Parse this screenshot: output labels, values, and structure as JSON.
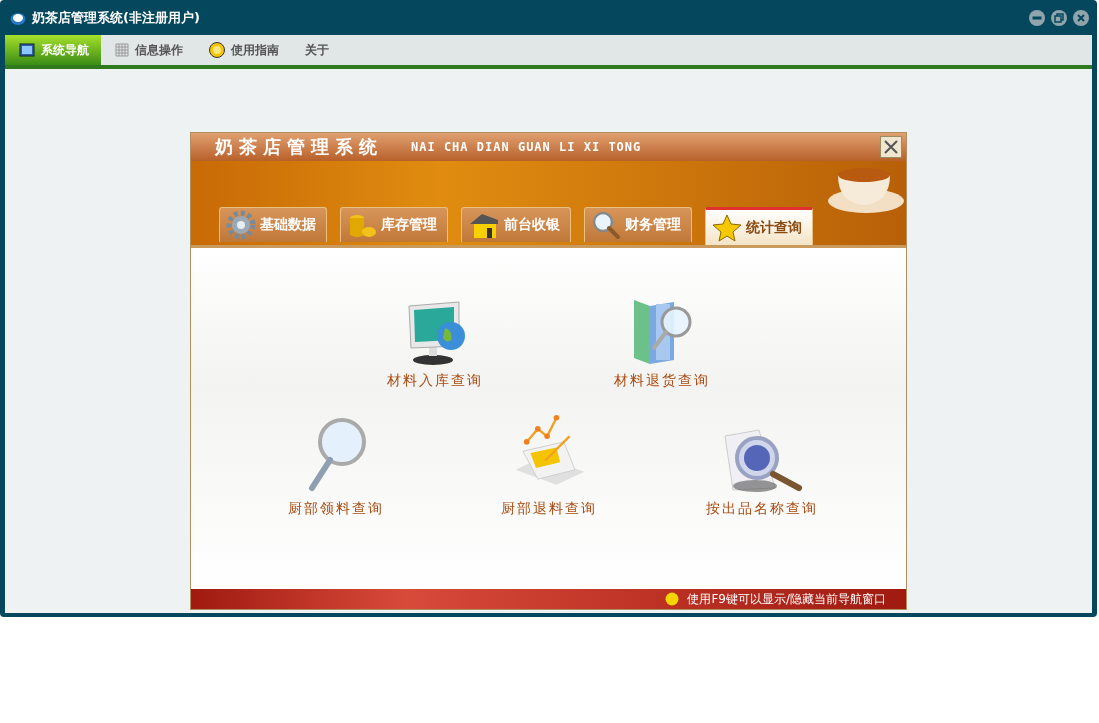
{
  "window": {
    "title": "奶茶店管理系统(非注册用户)"
  },
  "menu": [
    {
      "label": "系统导航",
      "selected": true
    },
    {
      "label": "信息操作",
      "selected": false
    },
    {
      "label": "使用指南",
      "selected": false
    },
    {
      "label": "关于",
      "selected": false
    }
  ],
  "dialog": {
    "title": "奶茶店管理系统",
    "subtitle": "NAI CHA DIAN GUAN LI XI TONG",
    "tabs": [
      {
        "label": "基础数据",
        "selected": false
      },
      {
        "label": "库存管理",
        "selected": false
      },
      {
        "label": "前台收银",
        "selected": false
      },
      {
        "label": "财务管理",
        "selected": false
      },
      {
        "label": "统计查询",
        "selected": true
      }
    ],
    "rows": [
      [
        {
          "label": "材料入库查询"
        },
        {
          "label": "材料退货查询"
        }
      ],
      [
        {
          "label": "厨部领料查询"
        },
        {
          "label": "厨部退料查询"
        },
        {
          "label": "按出品名称查询"
        }
      ]
    ],
    "status": "使用F9键可以显示/隐藏当前导航窗口"
  }
}
